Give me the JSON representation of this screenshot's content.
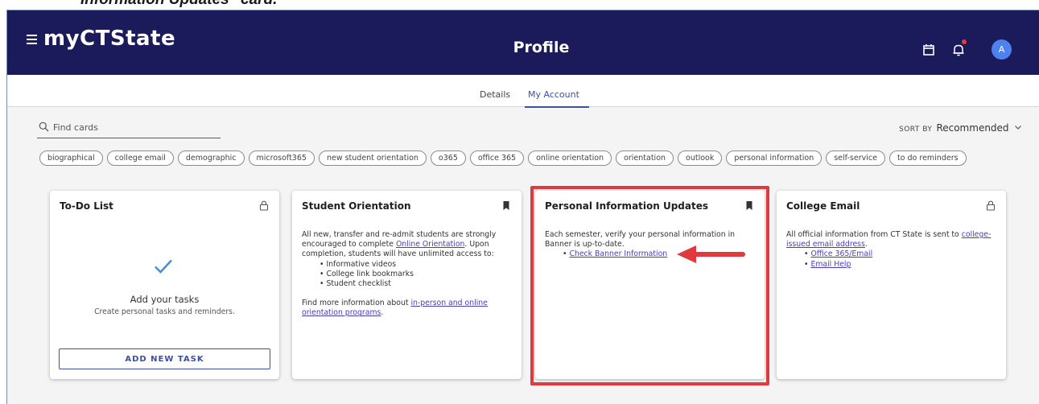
{
  "caption": "Information Updates\" card.",
  "header": {
    "brand": "myCTState",
    "title": "Profile",
    "avatar_initial": "A"
  },
  "tabs": [
    {
      "label": "Details",
      "active": false
    },
    {
      "label": "My Account",
      "active": true
    }
  ],
  "search": {
    "placeholder": "Find cards"
  },
  "sort": {
    "label": "SORT BY",
    "value": "Recommended"
  },
  "tags": [
    "biographical",
    "college email",
    "demographic",
    "microsoft365",
    "new student orientation",
    "o365",
    "office 365",
    "online orientation",
    "orientation",
    "outlook",
    "personal information",
    "self-service",
    "to do reminders"
  ],
  "cards": {
    "todo": {
      "title": "To-Do List",
      "empty_title": "Add your tasks",
      "empty_subtitle": "Create personal tasks and reminders.",
      "button": "ADD NEW TASK"
    },
    "orientation": {
      "title": "Student Orientation",
      "intro_before": "All new, transfer and re-admit students are strongly encouraged to complete ",
      "intro_link": "Online Orientation",
      "intro_after": ".  Upon completion, students will have unlimited access to:",
      "bullets": [
        "Informative videos",
        "College link bookmarks",
        "Student checklist"
      ],
      "more_before": "Find more information about ",
      "more_link": "in-person and online orientation programs",
      "more_after": "."
    },
    "personal": {
      "title": "Personal Information Updates",
      "text": "Each semester, verify your personal information in Banner is up-to-date.",
      "link": "Check Banner Information"
    },
    "email": {
      "title": "College Email",
      "text_before": "All official information from CT State is sent to ",
      "text_link": "college-issued email address",
      "text_after": ".",
      "links": [
        "Office 365/Email",
        "Email Help"
      ]
    }
  },
  "colors": {
    "header_bg": "#1b1b5c",
    "accent": "#3d4f9f",
    "link": "#4b3bbd",
    "highlight": "#e0393e",
    "avatar": "#4e80ee"
  }
}
